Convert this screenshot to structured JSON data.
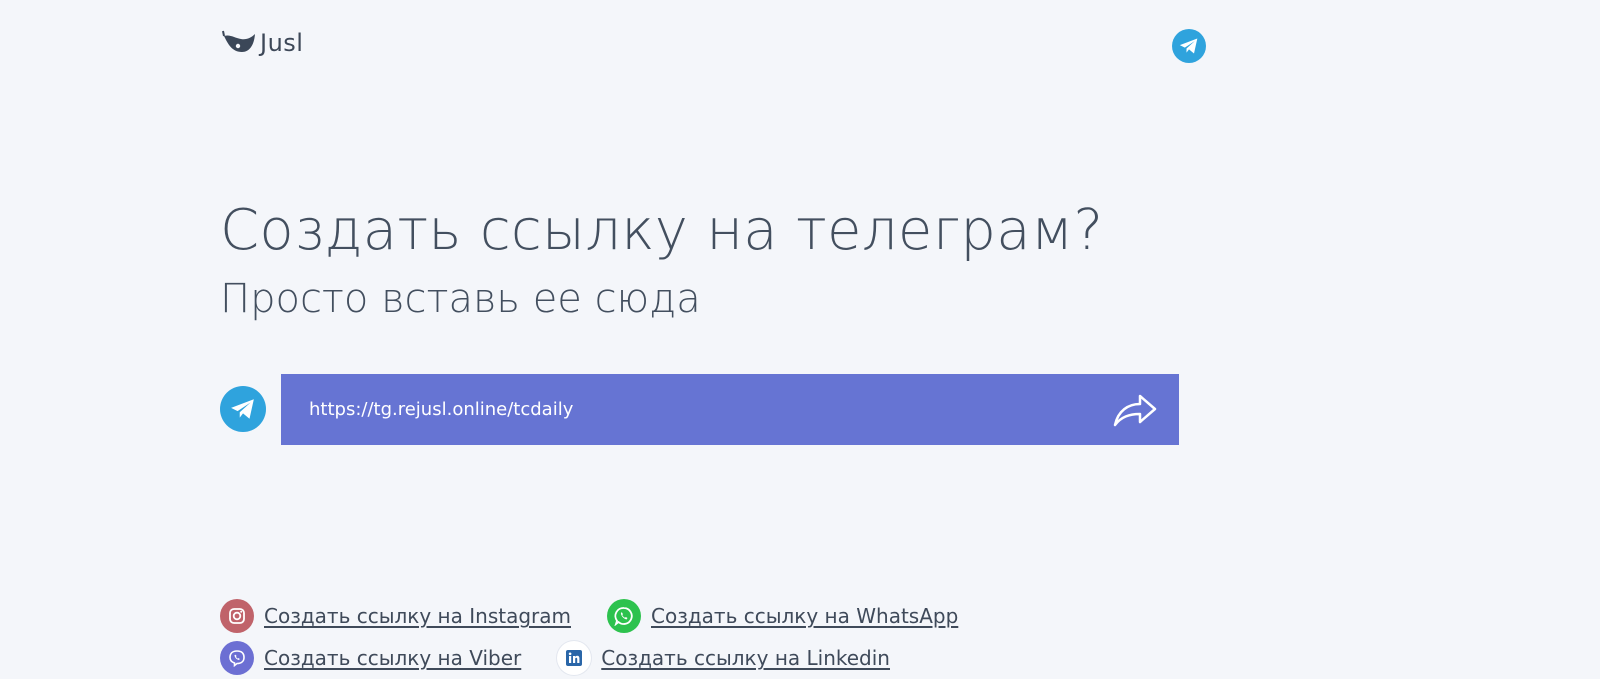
{
  "header": {
    "logo_text": "Jusl",
    "telegram_icon": "telegram-icon"
  },
  "hero": {
    "title": "Создать ссылку на телеграм?",
    "subtitle": "Просто вставь ее сюда"
  },
  "link_form": {
    "value": "https://tg.rejusl.online/tcdaily",
    "submit_icon": "share-arrow-icon"
  },
  "footer_links": [
    {
      "label": "Создать ссылку на Instagram",
      "icon": "instagram-icon",
      "color": "#c0636a"
    },
    {
      "label": "Создать ссылку на WhatsApp",
      "icon": "whatsapp-icon",
      "color": "#2dc24e"
    },
    {
      "label": "Создать ссылку на Viber",
      "icon": "viber-icon",
      "color": "#6c6fd3"
    },
    {
      "label": "Создать ссылку на Linkedin",
      "icon": "linkedin-icon",
      "color": "#2a66a8"
    }
  ],
  "colors": {
    "background": "#f4f6fa",
    "accent": "#6674d3",
    "telegram": "#2fa3dd"
  }
}
